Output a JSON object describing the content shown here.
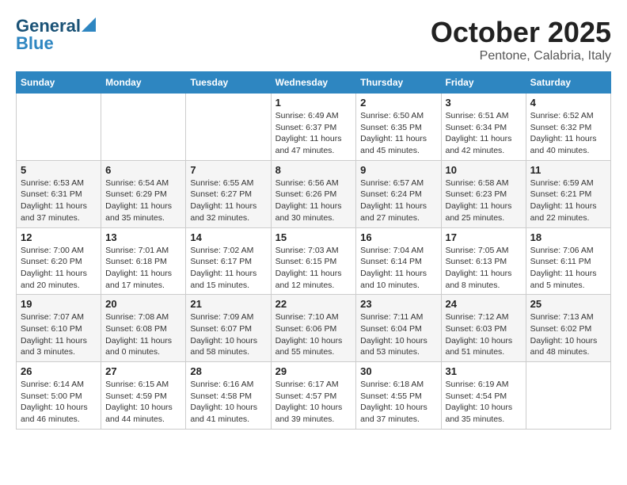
{
  "header": {
    "logo_general": "General",
    "logo_blue": "Blue",
    "month_title": "October 2025",
    "location": "Pentone, Calabria, Italy"
  },
  "weekdays": [
    "Sunday",
    "Monday",
    "Tuesday",
    "Wednesday",
    "Thursday",
    "Friday",
    "Saturday"
  ],
  "weeks": [
    [
      {
        "day": "",
        "info": ""
      },
      {
        "day": "",
        "info": ""
      },
      {
        "day": "",
        "info": ""
      },
      {
        "day": "1",
        "info": "Sunrise: 6:49 AM\nSunset: 6:37 PM\nDaylight: 11 hours\nand 47 minutes."
      },
      {
        "day": "2",
        "info": "Sunrise: 6:50 AM\nSunset: 6:35 PM\nDaylight: 11 hours\nand 45 minutes."
      },
      {
        "day": "3",
        "info": "Sunrise: 6:51 AM\nSunset: 6:34 PM\nDaylight: 11 hours\nand 42 minutes."
      },
      {
        "day": "4",
        "info": "Sunrise: 6:52 AM\nSunset: 6:32 PM\nDaylight: 11 hours\nand 40 minutes."
      }
    ],
    [
      {
        "day": "5",
        "info": "Sunrise: 6:53 AM\nSunset: 6:31 PM\nDaylight: 11 hours\nand 37 minutes."
      },
      {
        "day": "6",
        "info": "Sunrise: 6:54 AM\nSunset: 6:29 PM\nDaylight: 11 hours\nand 35 minutes."
      },
      {
        "day": "7",
        "info": "Sunrise: 6:55 AM\nSunset: 6:27 PM\nDaylight: 11 hours\nand 32 minutes."
      },
      {
        "day": "8",
        "info": "Sunrise: 6:56 AM\nSunset: 6:26 PM\nDaylight: 11 hours\nand 30 minutes."
      },
      {
        "day": "9",
        "info": "Sunrise: 6:57 AM\nSunset: 6:24 PM\nDaylight: 11 hours\nand 27 minutes."
      },
      {
        "day": "10",
        "info": "Sunrise: 6:58 AM\nSunset: 6:23 PM\nDaylight: 11 hours\nand 25 minutes."
      },
      {
        "day": "11",
        "info": "Sunrise: 6:59 AM\nSunset: 6:21 PM\nDaylight: 11 hours\nand 22 minutes."
      }
    ],
    [
      {
        "day": "12",
        "info": "Sunrise: 7:00 AM\nSunset: 6:20 PM\nDaylight: 11 hours\nand 20 minutes."
      },
      {
        "day": "13",
        "info": "Sunrise: 7:01 AM\nSunset: 6:18 PM\nDaylight: 11 hours\nand 17 minutes."
      },
      {
        "day": "14",
        "info": "Sunrise: 7:02 AM\nSunset: 6:17 PM\nDaylight: 11 hours\nand 15 minutes."
      },
      {
        "day": "15",
        "info": "Sunrise: 7:03 AM\nSunset: 6:15 PM\nDaylight: 11 hours\nand 12 minutes."
      },
      {
        "day": "16",
        "info": "Sunrise: 7:04 AM\nSunset: 6:14 PM\nDaylight: 11 hours\nand 10 minutes."
      },
      {
        "day": "17",
        "info": "Sunrise: 7:05 AM\nSunset: 6:13 PM\nDaylight: 11 hours\nand 8 minutes."
      },
      {
        "day": "18",
        "info": "Sunrise: 7:06 AM\nSunset: 6:11 PM\nDaylight: 11 hours\nand 5 minutes."
      }
    ],
    [
      {
        "day": "19",
        "info": "Sunrise: 7:07 AM\nSunset: 6:10 PM\nDaylight: 11 hours\nand 3 minutes."
      },
      {
        "day": "20",
        "info": "Sunrise: 7:08 AM\nSunset: 6:08 PM\nDaylight: 11 hours\nand 0 minutes."
      },
      {
        "day": "21",
        "info": "Sunrise: 7:09 AM\nSunset: 6:07 PM\nDaylight: 10 hours\nand 58 minutes."
      },
      {
        "day": "22",
        "info": "Sunrise: 7:10 AM\nSunset: 6:06 PM\nDaylight: 10 hours\nand 55 minutes."
      },
      {
        "day": "23",
        "info": "Sunrise: 7:11 AM\nSunset: 6:04 PM\nDaylight: 10 hours\nand 53 minutes."
      },
      {
        "day": "24",
        "info": "Sunrise: 7:12 AM\nSunset: 6:03 PM\nDaylight: 10 hours\nand 51 minutes."
      },
      {
        "day": "25",
        "info": "Sunrise: 7:13 AM\nSunset: 6:02 PM\nDaylight: 10 hours\nand 48 minutes."
      }
    ],
    [
      {
        "day": "26",
        "info": "Sunrise: 6:14 AM\nSunset: 5:00 PM\nDaylight: 10 hours\nand 46 minutes."
      },
      {
        "day": "27",
        "info": "Sunrise: 6:15 AM\nSunset: 4:59 PM\nDaylight: 10 hours\nand 44 minutes."
      },
      {
        "day": "28",
        "info": "Sunrise: 6:16 AM\nSunset: 4:58 PM\nDaylight: 10 hours\nand 41 minutes."
      },
      {
        "day": "29",
        "info": "Sunrise: 6:17 AM\nSunset: 4:57 PM\nDaylight: 10 hours\nand 39 minutes."
      },
      {
        "day": "30",
        "info": "Sunrise: 6:18 AM\nSunset: 4:55 PM\nDaylight: 10 hours\nand 37 minutes."
      },
      {
        "day": "31",
        "info": "Sunrise: 6:19 AM\nSunset: 4:54 PM\nDaylight: 10 hours\nand 35 minutes."
      },
      {
        "day": "",
        "info": ""
      }
    ]
  ]
}
